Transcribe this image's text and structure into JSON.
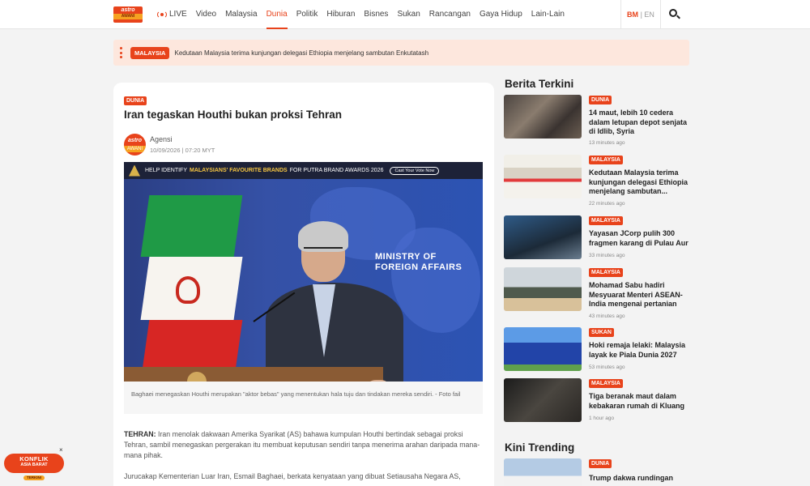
{
  "header": {
    "logo_top": "astro",
    "logo_bottom": "AWANI",
    "nav": [
      "LIVE",
      "Video",
      "Malaysia",
      "Dunia",
      "Politik",
      "Hiburan",
      "Bisnes",
      "Sukan",
      "Rancangan",
      "Gaya Hidup",
      "Lain-Lain"
    ],
    "active_nav": "Dunia",
    "lang_bm": "BM",
    "lang_sep": "|",
    "lang_en": "EN"
  },
  "ticker": {
    "badge": "MALAYSIA",
    "text": "Kedutaan Malaysia terima kunjungan delegasi Ethiopia menjelang sambutan Enkutatash"
  },
  "article": {
    "tag": "DUNIA",
    "title": "Iran tegaskan Houthi bukan proksi Tehran",
    "author": "Agensi",
    "date": "10/09/2026 | 07:20 MYT",
    "avatar_top": "astro",
    "avatar_bottom": "AWANI",
    "banner": {
      "pre": "HELP IDENTIFY",
      "highlight": "MALAYSIANS' FAVOURITE BRANDS",
      "post": "FOR PUTRA BRAND AWARDS 2026",
      "cta": "Cast Your Vote Now"
    },
    "image_text_line1": "MINISTRY OF",
    "image_text_line2": "FOREIGN AFFAIRS",
    "caption": "Baghaei menegaskan Houthi merupakan \"aktor bebas\" yang menentukan hala tuju dan tindakan mereka sendiri. - Foto fail",
    "p1_lead": "TEHRAN:",
    "p1": " Iran menolak dakwaan Amerika Syarikat (AS) bahawa kumpulan Houthi bertindak sebagai proksi Tehran, sambil menegaskan pergerakan itu membuat keputusan sendiri tanpa menerima arahan daripada mana-mana pihak.",
    "p2": "Jurucakap Kementerian Luar Iran, Esmail Baghaei, berkata kenyataan yang dibuat Setiausaha Negara AS,"
  },
  "sidebar": {
    "latest_title": "Berita Terkini",
    "latest": [
      {
        "tag": "DUNIA",
        "title": "14 maut, lebih 10 cedera dalam letupan depot senjata di Idlib, Syria",
        "time": "13 minutes ago"
      },
      {
        "tag": "MALAYSIA",
        "title": "Kedutaan Malaysia terima kunjungan delegasi Ethiopia menjelang sambutan...",
        "time": "22 minutes ago"
      },
      {
        "tag": "MALAYSIA",
        "title": "Yayasan JCorp pulih 300 fragmen karang di Pulau Aur",
        "time": "33 minutes ago"
      },
      {
        "tag": "MALAYSIA",
        "title": "Mohamad Sabu hadiri Mesyuarat Menteri ASEAN-India mengenai pertanian",
        "time": "43 minutes ago"
      },
      {
        "tag": "SUKAN",
        "title": "Hoki remaja lelaki: Malaysia layak ke Piala Dunia 2027",
        "time": "53 minutes ago"
      },
      {
        "tag": "MALAYSIA",
        "title": "Tiga beranak maut dalam kebakaran rumah di Kluang",
        "time": "1 hour ago"
      }
    ],
    "trending_title": "Kini Trending",
    "trending": [
      {
        "tag": "DUNIA",
        "title": "Trump dakwa rundingan"
      }
    ]
  },
  "promo": {
    "line1": "KONFLIK",
    "line2": "ASIA BARAT",
    "line3": "TERKINI",
    "close": "×"
  },
  "colors": {
    "accent": "#e8431b",
    "ticker_bg": "#fde7dd"
  }
}
